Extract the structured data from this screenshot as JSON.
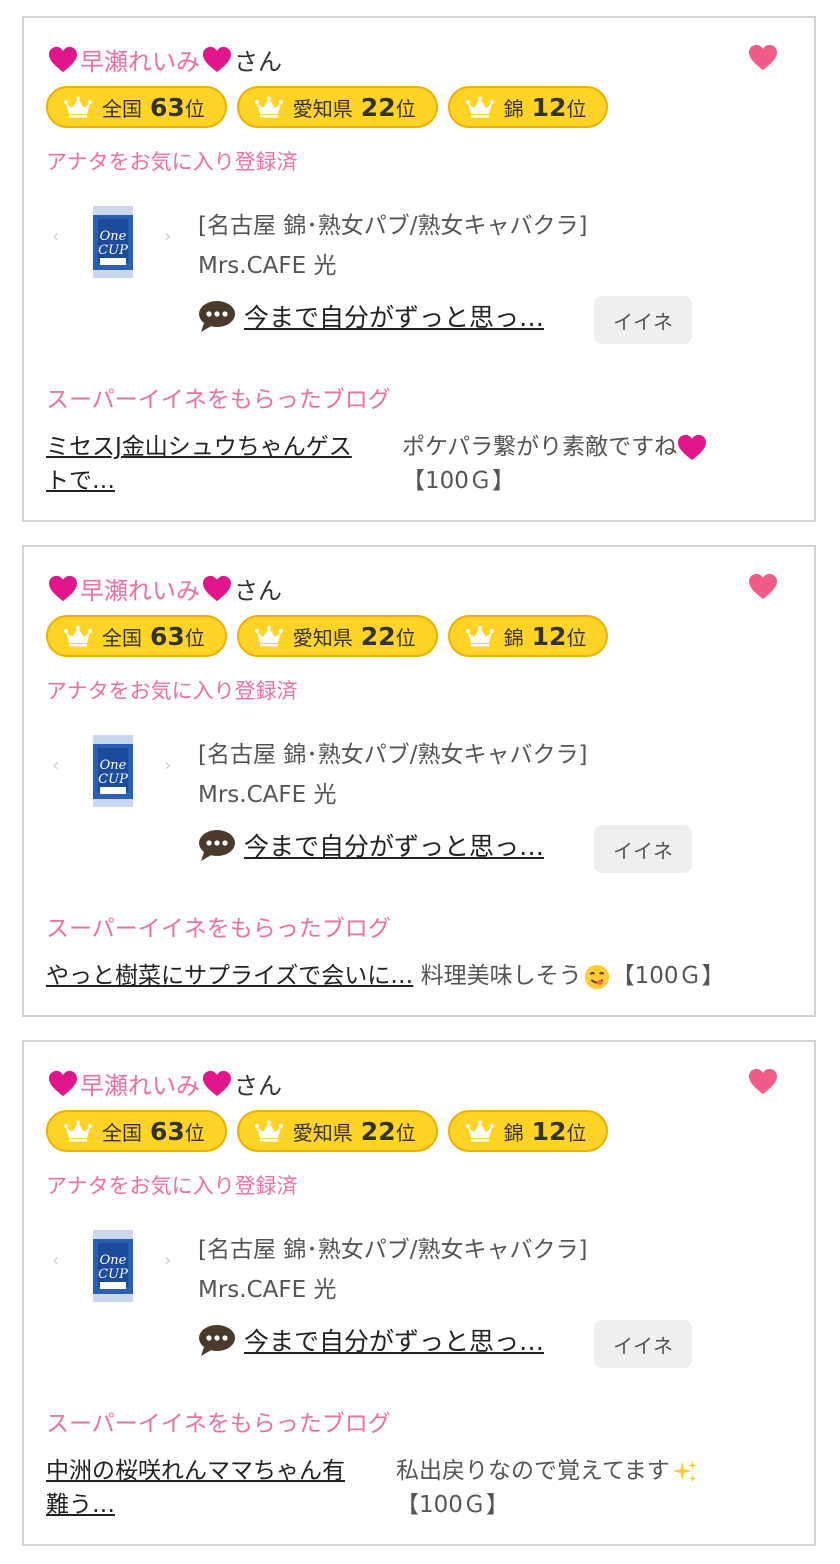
{
  "cards": [
    {
      "name": "早瀬れいみ",
      "honorific": "さん",
      "badges": [
        {
          "area": "全国",
          "rank": "63",
          "unit": "位"
        },
        {
          "area": "愛知県",
          "rank": "22",
          "unit": "位"
        },
        {
          "area": "錦",
          "rank": "12",
          "unit": "位"
        }
      ],
      "fav_status": "アナタをお気に入り登録済",
      "shop_category": "[名古屋 錦･熟女パブ/熟女キャバクラ]",
      "shop_name": "Mrs.CAFE 光",
      "message_link": "今まで自分がずっと思っ…",
      "iine_label": "イイネ",
      "super_label": "スーパーイイネをもらったブログ",
      "blog_link": "ミセスJ金山シュウちゃんゲスト で…",
      "blog_link_line1": "ミセスJ金山シュウちゃんゲス",
      "blog_link_line2": "トで…",
      "comment": "ポケパラ繋がり素敵ですね",
      "comment_emoji": "heart-emoji",
      "points": "【100Ｇ】"
    },
    {
      "name": "早瀬れいみ",
      "honorific": "さん",
      "badges": [
        {
          "area": "全国",
          "rank": "63",
          "unit": "位"
        },
        {
          "area": "愛知県",
          "rank": "22",
          "unit": "位"
        },
        {
          "area": "錦",
          "rank": "12",
          "unit": "位"
        }
      ],
      "fav_status": "アナタをお気に入り登録済",
      "shop_category": "[名古屋 錦･熟女パブ/熟女キャバクラ]",
      "shop_name": "Mrs.CAFE 光",
      "message_link": "今まで自分がずっと思っ…",
      "iine_label": "イイネ",
      "super_label": "スーパーイイネをもらったブログ",
      "blog_link": "やっと樹菜にサプライズで会いに…",
      "comment": "料理美味しそう",
      "comment_emoji": "yum-face-emoji",
      "points": "【100Ｇ】"
    },
    {
      "name": "早瀬れいみ",
      "honorific": "さん",
      "badges": [
        {
          "area": "全国",
          "rank": "63",
          "unit": "位"
        },
        {
          "area": "愛知県",
          "rank": "22",
          "unit": "位"
        },
        {
          "area": "錦",
          "rank": "12",
          "unit": "位"
        }
      ],
      "fav_status": "アナタをお気に入り登録済",
      "shop_category": "[名古屋 錦･熟女パブ/熟女キャバクラ]",
      "shop_name": "Mrs.CAFE 光",
      "message_link": "今まで自分がずっと思っ…",
      "iine_label": "イイネ",
      "super_label": "スーパーイイネをもらったブログ",
      "blog_link_line1": "中洲の桜咲れんママちゃん有",
      "blog_link_line2": "難う…",
      "comment": "私出戻りなので覚えてます",
      "comment_emoji": "sparkles-emoji",
      "points": "【100Ｇ】"
    }
  ],
  "colors": {
    "pink_text": "#ef6fa3",
    "badge_fill": "#ffd426",
    "badge_border": "#f0b000",
    "heart_magenta": "#e0168a",
    "fav_heart": "#f25c88"
  }
}
